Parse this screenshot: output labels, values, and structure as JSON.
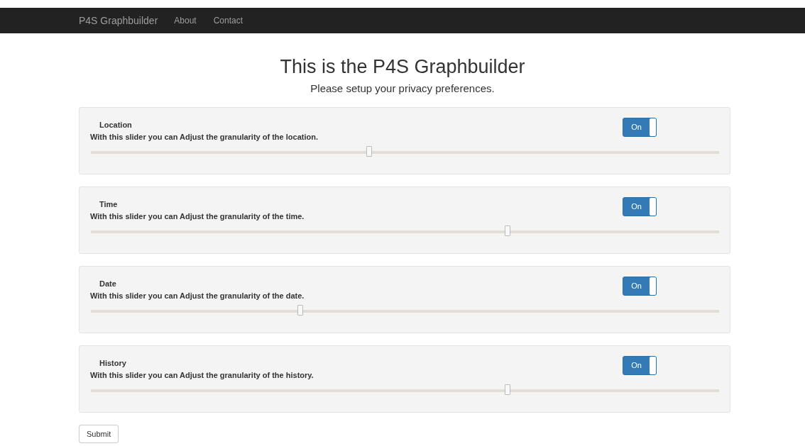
{
  "navbar": {
    "brand": "P4S Graphbuilder",
    "links": [
      "About",
      "Contact"
    ]
  },
  "heading": "This is the P4S Graphbuilder",
  "subheading": "Please setup your privacy preferences.",
  "preferences": [
    {
      "title": "Location",
      "description": "With this slider you can Adjust the granularity of the location.",
      "toggle": {
        "label": "On",
        "on": true
      },
      "level": 0.444
    },
    {
      "title": "Time",
      "description": "With this slider you can Adjust the granularity of the time.",
      "toggle": {
        "label": "On",
        "on": true
      },
      "level": 0.664
    },
    {
      "title": "Date",
      "description": "With this slider you can Adjust the granularity of the date.",
      "toggle": {
        "label": "On",
        "on": true
      },
      "level": 0.335
    },
    {
      "title": "History",
      "description": "With this slider you can Adjust the granularity of the history.",
      "toggle": {
        "label": "On",
        "on": true
      },
      "level": 0.664
    }
  ],
  "submit": "Submit"
}
